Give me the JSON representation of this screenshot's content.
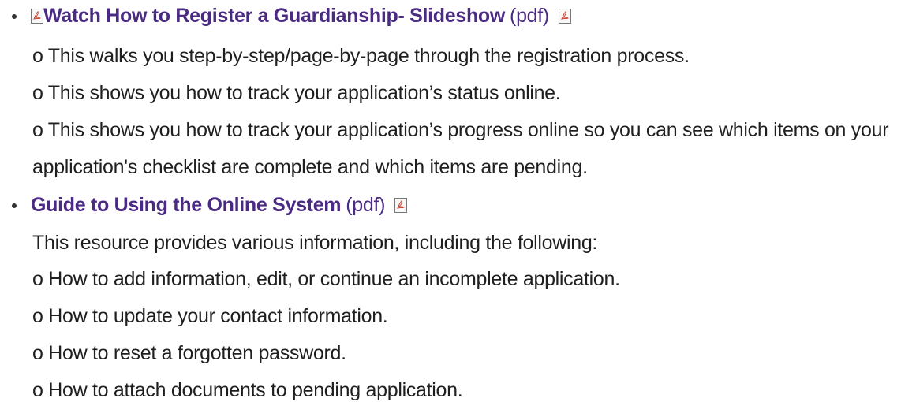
{
  "items": [
    {
      "link_text": "Watch How to Register a Guardianship- Slideshow",
      "suffix": "(pdf)",
      "details": [
        "o This walks you step-by-step/page-by-page through the registration process.",
        "o This shows you how to track your application’s status online.",
        "o This shows you how to track your application’s progress online so you can see which items on your",
        "application's checklist are complete and which items are pending."
      ]
    },
    {
      "link_text": "Guide to Using the Online System",
      "suffix": "(pdf)",
      "details": [
        "This resource provides various information, including the following:",
        "o How to add information, edit, or continue an incomplete application.",
        "o How to update your contact information.",
        "o How to reset a forgotten password.",
        "o How to attach documents to pending application."
      ]
    }
  ],
  "icons": {
    "pdf": "pdf-icon"
  },
  "colors": {
    "link": "#4b2a84",
    "text": "#1f1f1f"
  }
}
